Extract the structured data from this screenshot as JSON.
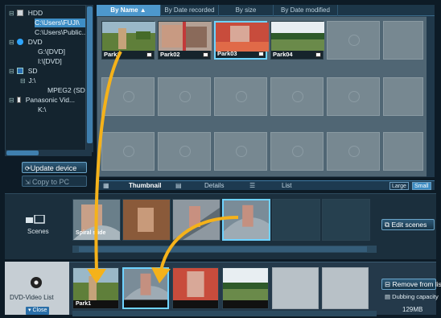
{
  "tree": {
    "items": [
      {
        "label": "HDD",
        "icon": "hard-drive-icon",
        "expander": "⊟"
      },
      {
        "label": "C:\\Users\\FUJI\\",
        "icon": "",
        "expander": "",
        "selected": true
      },
      {
        "label": "C:\\Users\\Public...",
        "icon": "",
        "expander": ""
      },
      {
        "label": "DVD",
        "icon": "disc-icon",
        "expander": "⊟"
      },
      {
        "label": "G:\\[DVD]",
        "icon": "",
        "expander": ""
      },
      {
        "label": "I:\\[DVD]",
        "icon": "",
        "expander": ""
      },
      {
        "label": "SD",
        "icon": "sd-card-icon",
        "expander": "⊟"
      },
      {
        "label": "J:\\",
        "icon": "",
        "expander": "⊟"
      },
      {
        "label": "MPEG2 (SD...",
        "icon": "",
        "expander": ""
      },
      {
        "label": "Panasonic Vid...",
        "icon": "camera-icon",
        "expander": "⊟"
      },
      {
        "label": "K:\\",
        "icon": "",
        "expander": ""
      }
    ]
  },
  "buttons": {
    "update_device": "Update device",
    "copy_to_pc": "Copy to PC",
    "edit_scenes": "Edit scenes",
    "remove_from_list": "Remove from list",
    "dubbing_capacity": "Dubbing capacity",
    "close": "Close"
  },
  "sort_tabs": [
    "By Name ▲",
    "By Date recorded",
    "By size",
    "By Date modified"
  ],
  "thumbnails": [
    {
      "caption": "Park1"
    },
    {
      "caption": "Park02"
    },
    {
      "caption": "Park03"
    },
    {
      "caption": "Park04"
    }
  ],
  "view_tabs": [
    "Thumbnail",
    "Details",
    "List"
  ],
  "size_buttons": [
    "Large",
    "Small"
  ],
  "scenes": {
    "label": "Scenes",
    "first_caption": "Spiral slide"
  },
  "dvd": {
    "label": "DVD-Video List",
    "first_caption": "Park1",
    "capacity": "129MB"
  },
  "colors": {
    "accent": "#4d98cd",
    "arrow": "#f5b21a",
    "selection": "#6fd3ff"
  }
}
